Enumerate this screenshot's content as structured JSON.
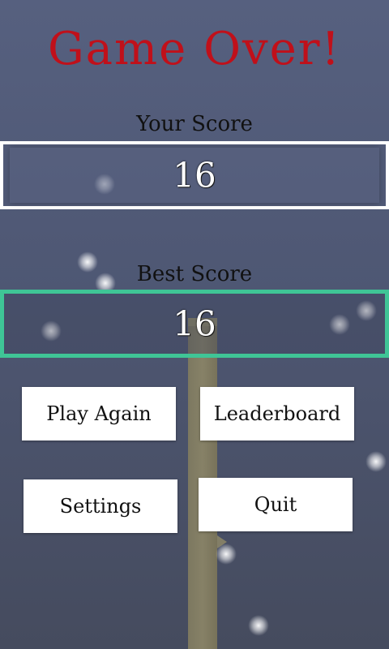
{
  "title": "Game Over!",
  "your_score": {
    "label": "Your Score",
    "value": "16"
  },
  "best_score": {
    "label": "Best Score",
    "value": "16"
  },
  "buttons": {
    "play_again": "Play Again",
    "leaderboard": "Leaderboard",
    "settings": "Settings",
    "quit": "Quit"
  },
  "colors": {
    "title": "#c0101a",
    "best_border": "#3fc596",
    "your_border": "#ffffff",
    "background": "#56607f"
  }
}
